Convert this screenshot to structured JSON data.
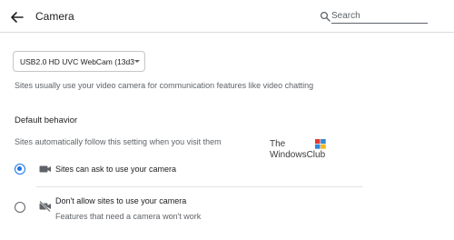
{
  "header": {
    "title": "Camera",
    "search_placeholder": "Search",
    "back_icon": "arrow-left-icon",
    "search_icon": "search-icon"
  },
  "camera_select": {
    "value": "USB2.0 HD UVC WebCam (13d3"
  },
  "description": "Sites usually use your video camera for communication features like video chatting",
  "default_behavior": {
    "title": "Default behavior",
    "subtitle": "Sites automatically follow this setting when you visit them",
    "options": [
      {
        "label": "Sites can ask to use your camera",
        "icon": "camera-icon",
        "selected": true
      },
      {
        "label": "Don't allow sites to use your camera",
        "sublabel": "Features that need a camera won't work",
        "icon": "camera-off-icon",
        "selected": false
      }
    ]
  },
  "watermark": {
    "line1": "The",
    "line2": "WindowsClub"
  },
  "colors": {
    "accent": "#1a73e8",
    "text": "#202124",
    "secondary": "#5f6368"
  }
}
